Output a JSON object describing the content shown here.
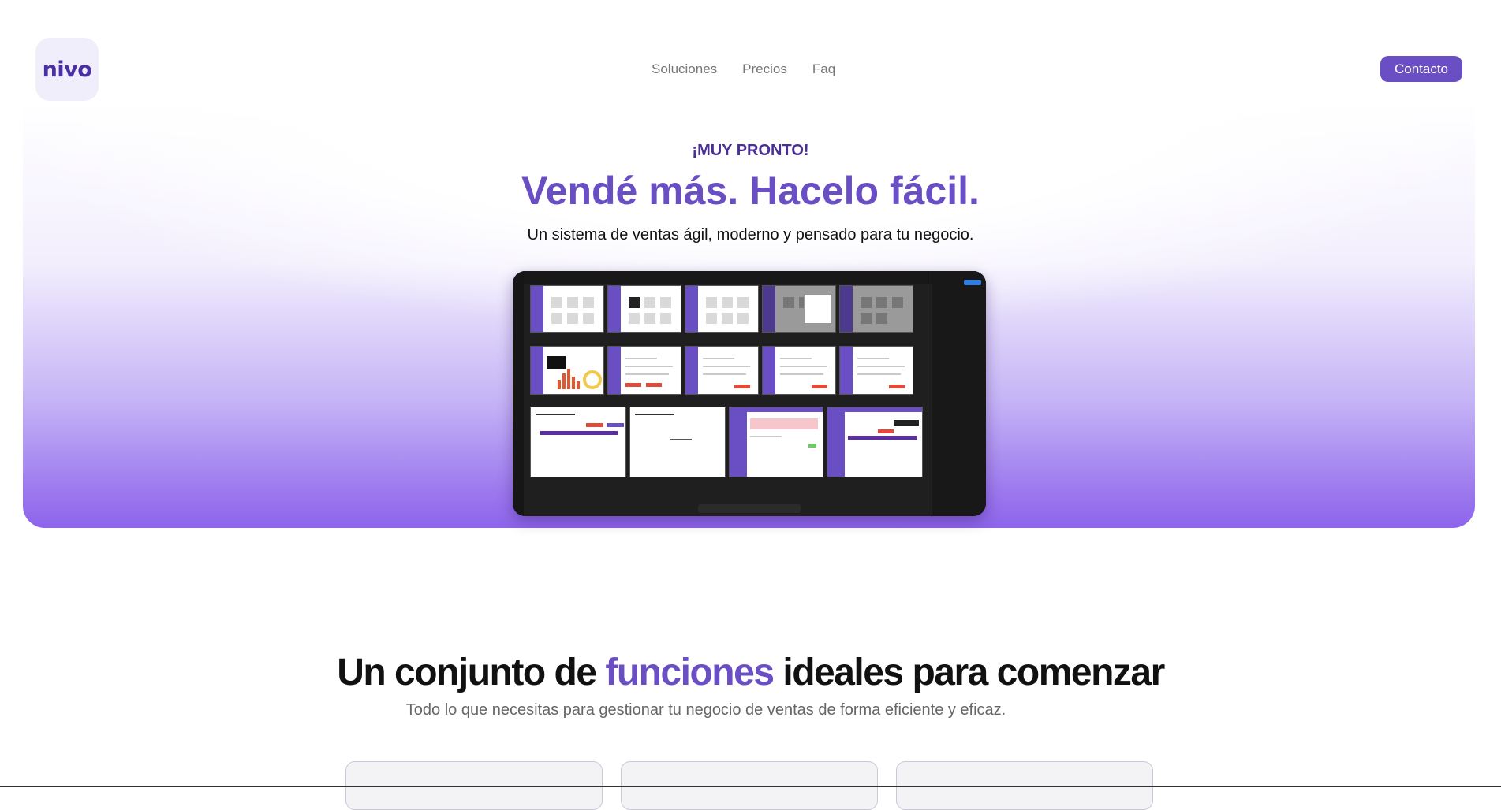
{
  "header": {
    "logo_text": "nivo",
    "nav": [
      {
        "label": "Soluciones"
      },
      {
        "label": "Precios"
      },
      {
        "label": "Faq"
      }
    ],
    "contact_label": "Contacto"
  },
  "hero": {
    "badge": "¡MUY PRONTO!",
    "title": "Vendé más. Hacelo fácil.",
    "subtitle": "Un sistema de ventas ágil, moderno y pensado para tu negocio."
  },
  "features": {
    "title_part1": "Un conjunto de ",
    "title_accent": "funciones",
    "title_part2": " ideales para comenzar",
    "subtitle": "Todo lo que necesitas para gestionar tu negocio de ventas de forma eficiente y eficaz."
  },
  "colors": {
    "brand": "#6a4fc4",
    "brand_dark": "#4a2d95",
    "hero_gradient_end": "#8d64eb"
  },
  "icons": {
    "logo": "nivo-logo"
  }
}
